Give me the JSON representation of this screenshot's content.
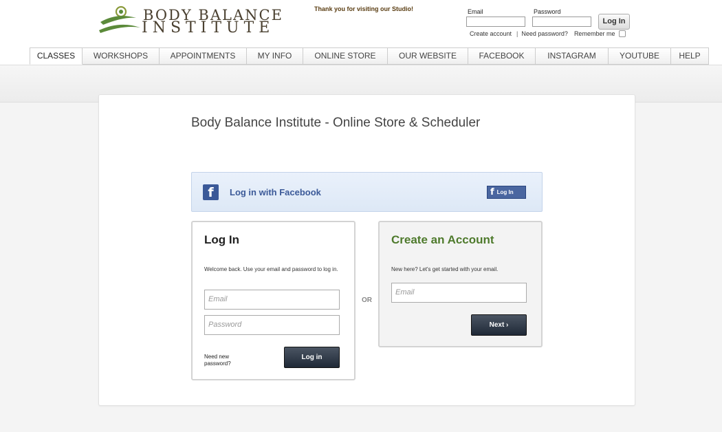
{
  "brand": {
    "line1": "BODY BALANCE",
    "line2": "INSTITUTE",
    "logo_icon": "spiral-swoosh-logo"
  },
  "header": {
    "thanks": "Thank you for visiting our Studio!",
    "email_label": "Email",
    "password_label": "Password",
    "email_value": "",
    "password_value": "",
    "login_button": "Log In",
    "create_account": "Create account",
    "separator": "|",
    "need_password": "Need password?",
    "remember_me": "Remember me",
    "remember_checked": false
  },
  "nav": {
    "tabs": [
      {
        "label": "CLASSES",
        "active": true
      },
      {
        "label": "WORKSHOPS",
        "active": false
      },
      {
        "label": "APPOINTMENTS",
        "active": false
      },
      {
        "label": "MY INFO",
        "active": false
      },
      {
        "label": "ONLINE STORE",
        "active": false
      },
      {
        "label": "OUR WEBSITE",
        "active": false
      },
      {
        "label": "FACEBOOK",
        "active": false
      },
      {
        "label": "INSTAGRAM",
        "active": false
      },
      {
        "label": "YOUTUBE",
        "active": false
      },
      {
        "label": "HELP",
        "active": false
      }
    ]
  },
  "main": {
    "title": "Body Balance Institute - Online Store & Scheduler",
    "facebook": {
      "text": "Log in with Facebook",
      "button_label": "Log In",
      "icon": "facebook-f-icon"
    },
    "login": {
      "heading": "Log In",
      "description": "Welcome back. Use your email and password to log in.",
      "email_placeholder": "Email",
      "password_placeholder": "Password",
      "need_password": "Need new password?",
      "button": "Log in"
    },
    "or": "OR",
    "create": {
      "heading": "Create an Account",
      "description": "New here? Let's get started with your email.",
      "email_placeholder": "Email",
      "button": "Next ›"
    }
  },
  "colors": {
    "facebook_blue": "#3b5998",
    "create_heading_green": "#4e7a2c",
    "brand_brown": "#4a4030",
    "logo_green": "#5b8a3a"
  }
}
